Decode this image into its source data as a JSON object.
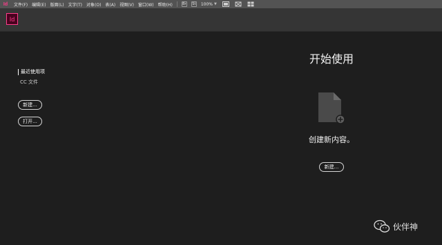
{
  "menubar": {
    "app_glyph": "Id",
    "menus": [
      "文件(F)",
      "编辑(E)",
      "版面(L)",
      "文字(T)",
      "对象(O)",
      "表(A)",
      "视图(V)",
      "窗口(W)",
      "帮助(H)"
    ],
    "tool_br": "Br",
    "tool_st": "St",
    "zoom": "100%"
  },
  "appbar": {
    "logo": "Id"
  },
  "left": {
    "recent_label": "最近使用项",
    "cc_files_label": "CC 文件",
    "new_button": "新建...",
    "open_button": "打开..."
  },
  "main": {
    "title": "开始使用",
    "create_text": "创建新内容。",
    "new_button": "新建..."
  },
  "watermark": {
    "text": "伙伴神"
  },
  "colors": {
    "menubar_bg": "#535353",
    "appbar_bg": "#353535",
    "body_bg": "#1e1e1e",
    "brand": "#ff3d8b",
    "brand_dark": "#49021f"
  },
  "icons": {
    "new_document": "new-document-icon",
    "wechat": "wechat-icon"
  }
}
